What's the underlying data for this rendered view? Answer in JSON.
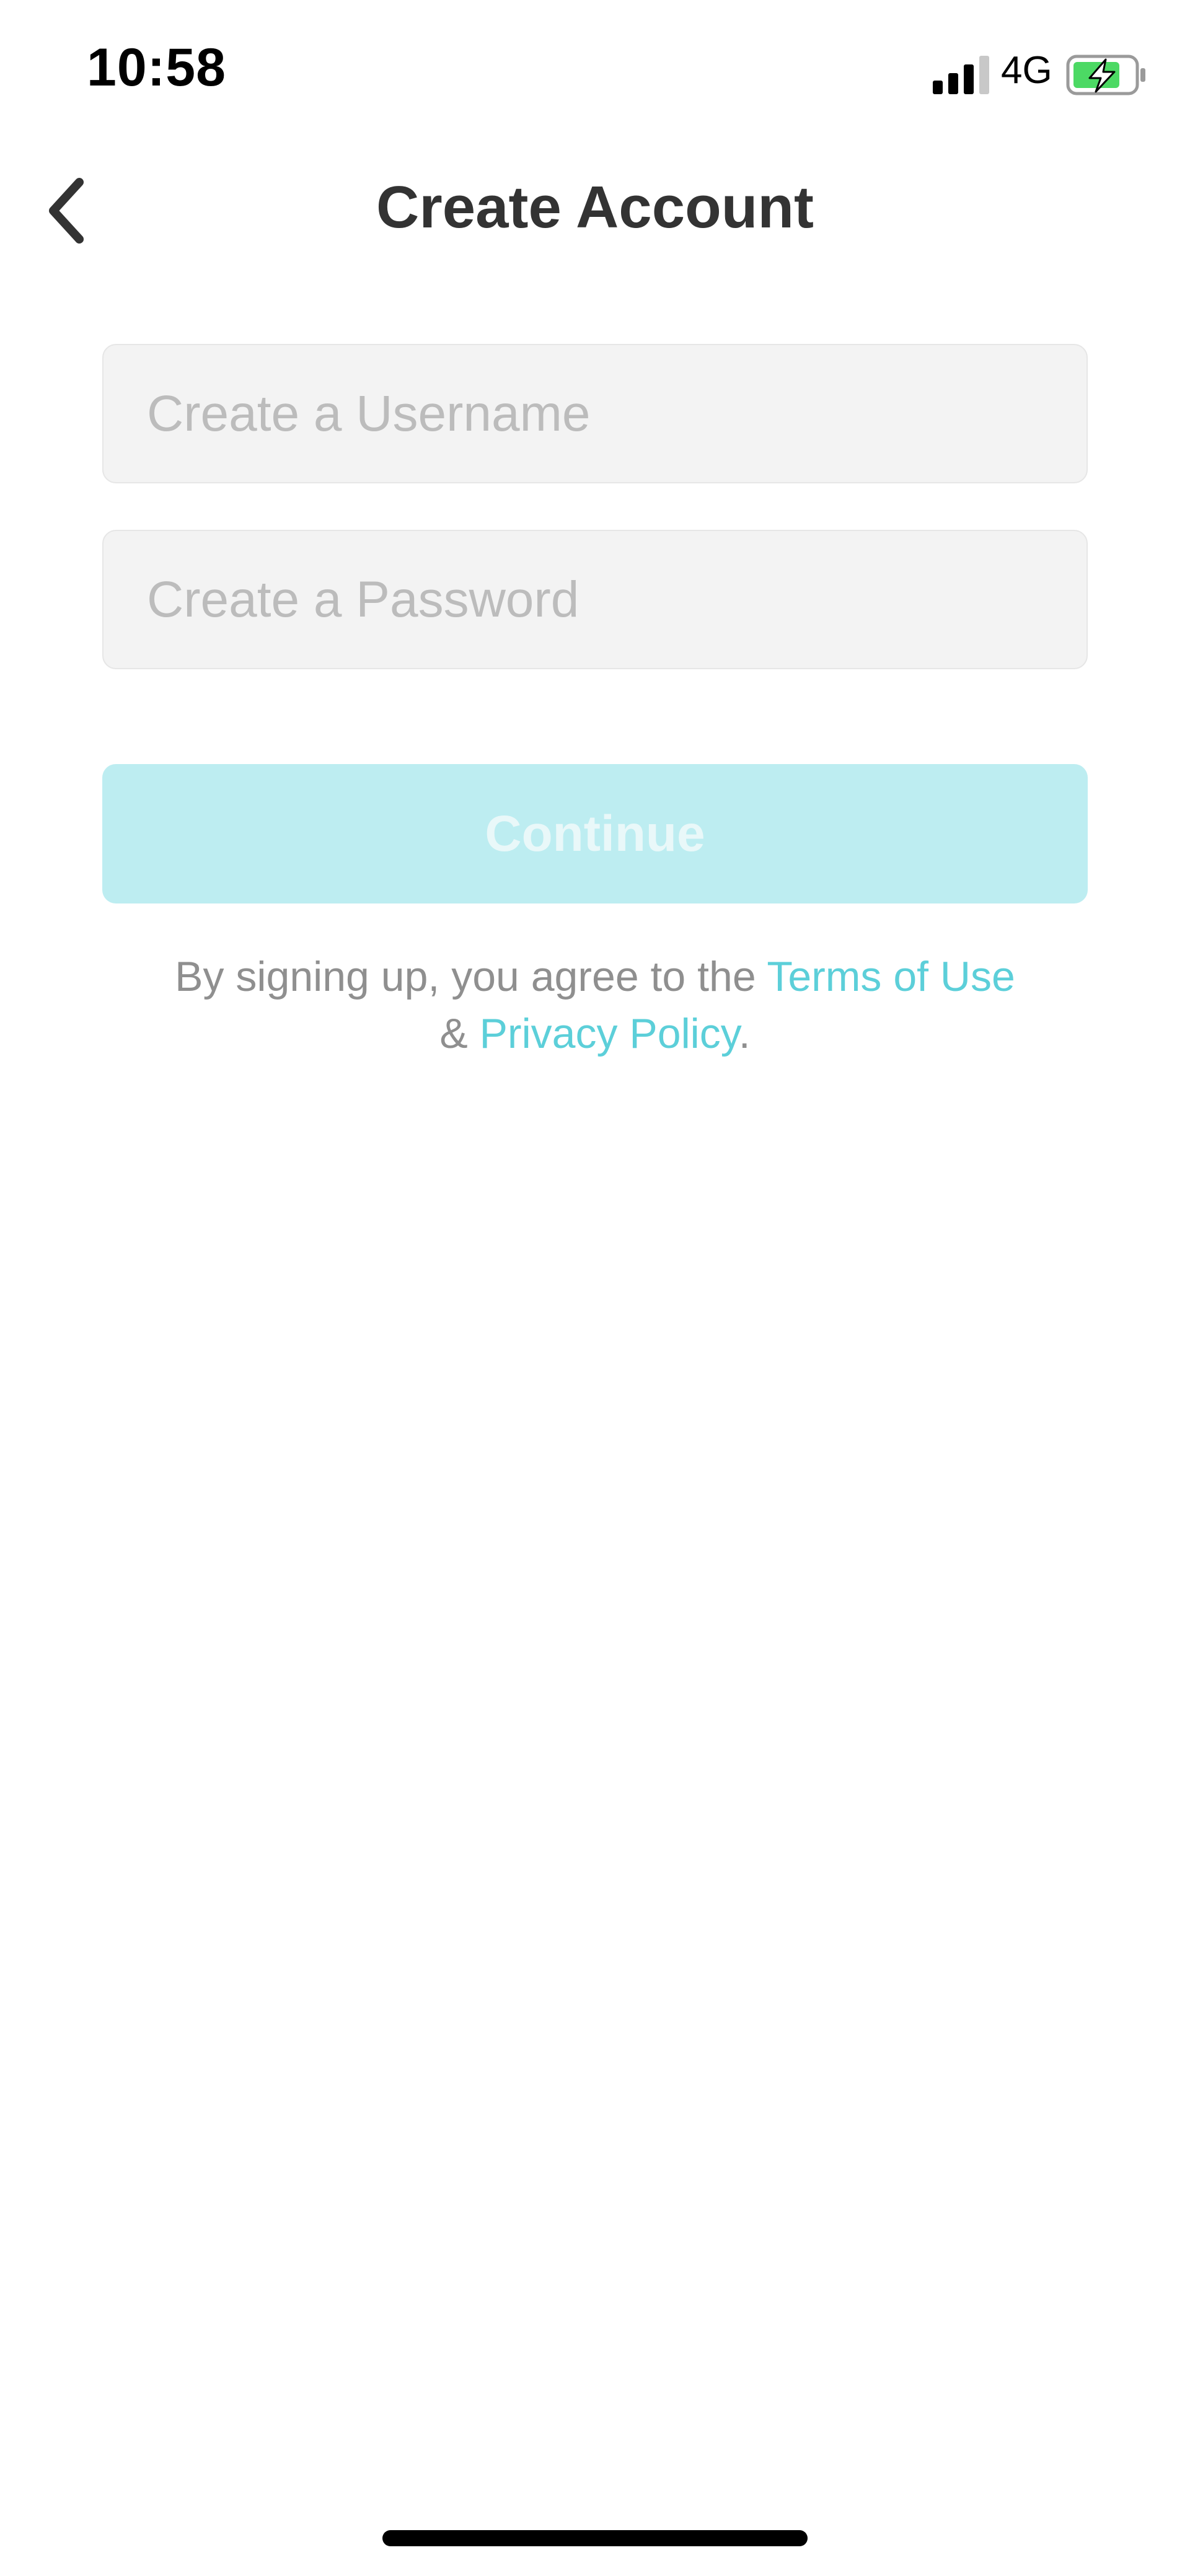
{
  "status_bar": {
    "time": "10:58",
    "network": "4G",
    "signal_icon": "cellular-signal-icon",
    "battery_icon": "battery-charging-icon",
    "battery_color": "#4cd964"
  },
  "header": {
    "title": "Create Account",
    "back_icon": "chevron-left-icon"
  },
  "form": {
    "username_placeholder": "Create a Username",
    "username_value": "",
    "password_placeholder": "Create a Password",
    "password_value": "",
    "continue_label": "Continue"
  },
  "legal": {
    "prefix": "By signing up, you agree to the ",
    "terms_link": "Terms of Use",
    "amp": "& ",
    "privacy_link": "Privacy Policy",
    "suffix": "."
  },
  "colors": {
    "accent": "#5ccfd9",
    "button_disabled": "#bdedf1",
    "field_bg": "#f3f3f3"
  }
}
